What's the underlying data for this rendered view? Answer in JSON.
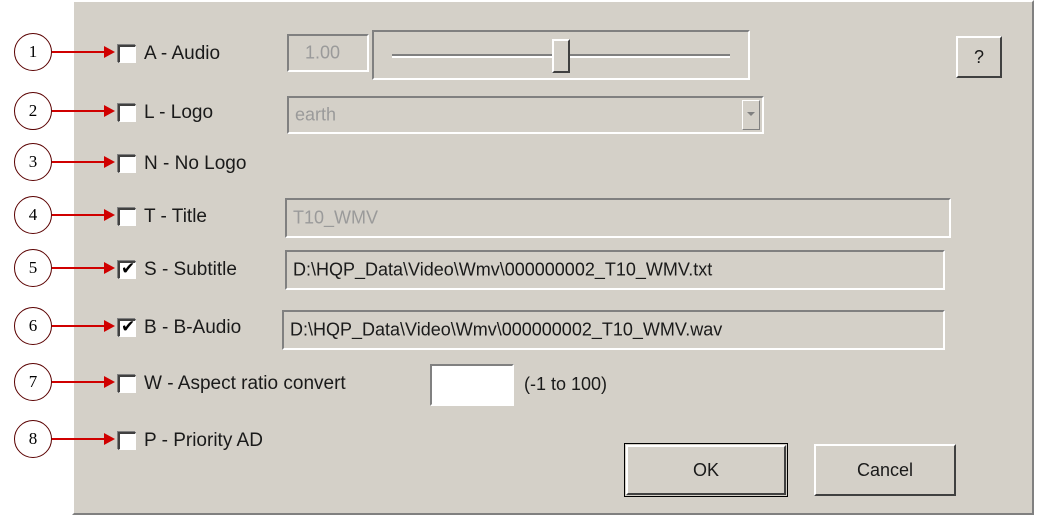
{
  "dialog": {
    "help_label": "?",
    "ok_label": "OK",
    "cancel_label": "Cancel"
  },
  "callouts": [
    "1",
    "2",
    "3",
    "4",
    "5",
    "6",
    "7",
    "8"
  ],
  "options": [
    {
      "label": "A - Audio",
      "checked": false
    },
    {
      "label": "L - Logo",
      "checked": false
    },
    {
      "label": "N - No Logo",
      "checked": false
    },
    {
      "label": "T - Title",
      "checked": false
    },
    {
      "label": "S - Subtitle",
      "checked": true
    },
    {
      "label": "B - B-Audio",
      "checked": true
    },
    {
      "label": "W - Aspect ratio convert",
      "checked": false
    },
    {
      "label": "P - Priority AD",
      "checked": false
    }
  ],
  "audio": {
    "value": "1.00",
    "slider_fraction": 0.5
  },
  "logo": {
    "selected": "earth"
  },
  "title": {
    "value": "T10_WMV"
  },
  "subtitle": {
    "value": "D:\\HQP_Data\\Video\\Wmv\\000000002_T10_WMV.txt"
  },
  "b_audio": {
    "value": "D:\\HQP_Data\\Video\\Wmv\\000000002_T10_WMV.wav"
  },
  "aspect": {
    "value": "",
    "range_label": "(-1 to 100)"
  },
  "colors": {
    "dialog_bg": "#d4d0c8",
    "callout_arrow": "#d00000",
    "disabled_text": "#9a9a9a"
  }
}
